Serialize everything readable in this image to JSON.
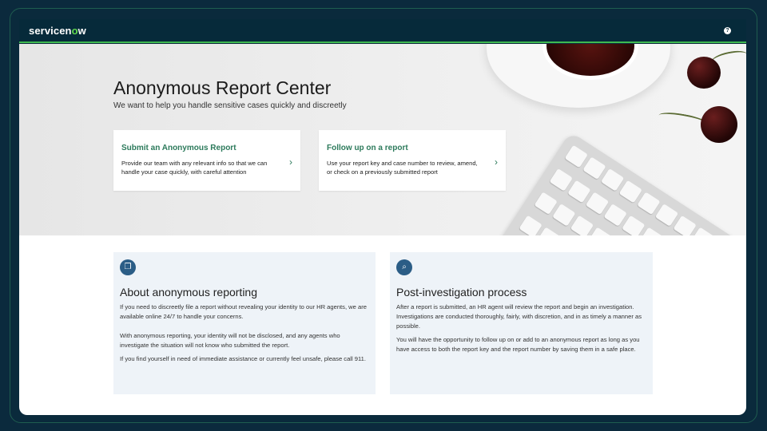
{
  "header": {
    "brand_prefix": "servicen",
    "brand_o": "o",
    "brand_suffix": "w",
    "help_glyph": "?"
  },
  "hero": {
    "title": "Anonymous Report Center",
    "subtitle": "We want to help you handle sensitive cases quickly and discreetly"
  },
  "cards": [
    {
      "title": "Submit an Anonymous Report",
      "description": "Provide our team with any relevant info so that we can handle your case quickly, with careful attention",
      "chevron": "›"
    },
    {
      "title": "Follow up on a report",
      "description": "Use your report key and case number to review, amend, or check on a previously submitted report",
      "chevron": "›"
    }
  ],
  "info": [
    {
      "icon": "document-icon",
      "icon_glyph": "❐",
      "title": "About anonymous reporting",
      "paragraphs": [
        "If you need to discreetly file a report without revealing your identity to our HR agents, we are available online 24/7 to handle your concerns.",
        "With anonymous reporting, your identity will not be disclosed, and any agents who investigate the situation will not know who submitted the report.",
        "If you find yourself in need of immediate assistance or currently feel unsafe, please call 911."
      ]
    },
    {
      "icon": "search-icon",
      "icon_glyph": "⌕",
      "title": "Post-investigation process",
      "paragraphs": [
        "After a report is submitted, an HR agent will review the report and begin an investigation. Investigations are conducted thoroughly, fairly, with discretion, and in as timely a manner as possible.",
        "You will have the opportunity to follow up on or add to an anonymous report as long as you have access to both the report key and the report number by saving them in a safe place."
      ]
    }
  ],
  "colors": {
    "topbar": "#062a3a",
    "accent_green": "#2c7a5b",
    "brand_green": "#62d84e",
    "icon_blue": "#2b5d86",
    "panel_bg": "#eef3f8"
  }
}
